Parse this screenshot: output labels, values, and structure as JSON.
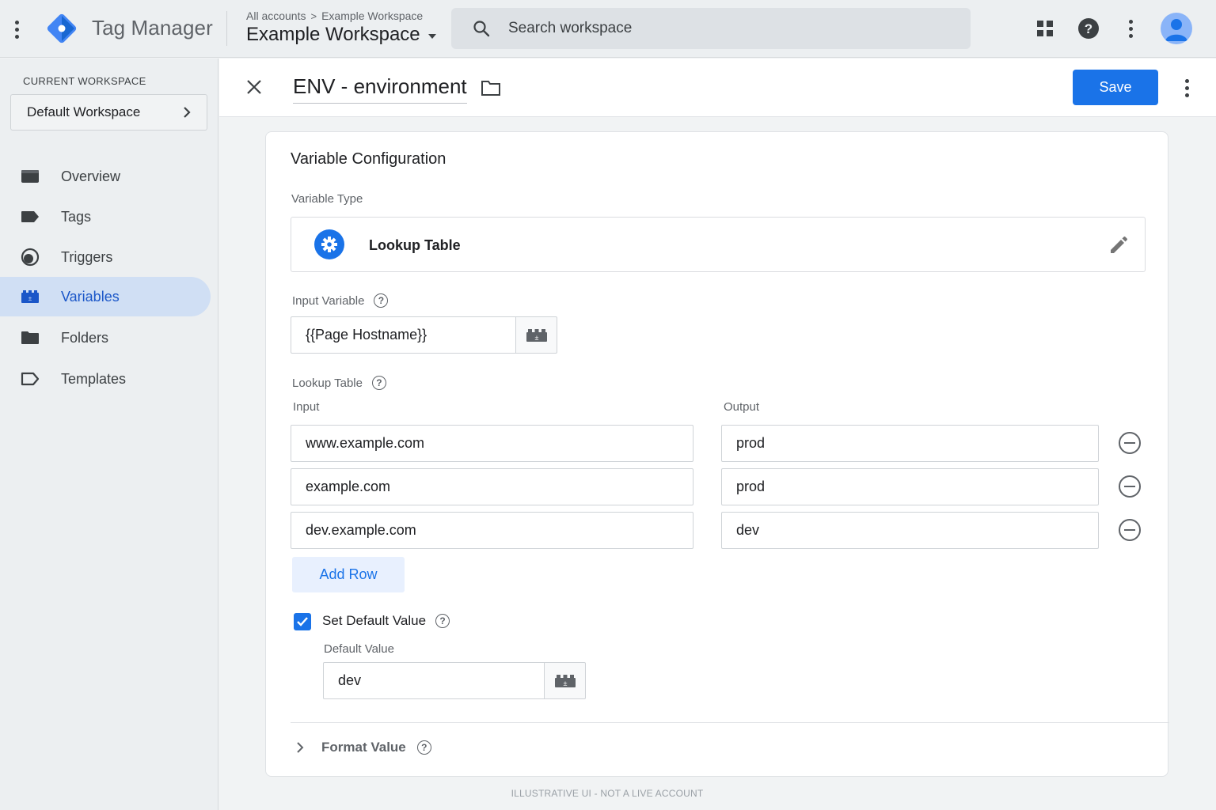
{
  "app": {
    "product_name": "Tag Manager",
    "breadcrumb": [
      "All accounts",
      "Example Workspace"
    ],
    "breadcrumb_sep": ">",
    "workspace_title": "Example Workspace",
    "search_placeholder": "Search workspace",
    "accent_color": "#1a73e8"
  },
  "sidebar": {
    "current_workspace_label": "CURRENT WORKSPACE",
    "workspace_name": "Default Workspace",
    "items": [
      {
        "label": "Overview",
        "icon": "overview-icon"
      },
      {
        "label": "Tags",
        "icon": "tag-icon"
      },
      {
        "label": "Triggers",
        "icon": "trigger-icon"
      },
      {
        "label": "Variables",
        "icon": "variables-icon",
        "active": true
      },
      {
        "label": "Folders",
        "icon": "folder-icon"
      },
      {
        "label": "Templates",
        "icon": "template-icon"
      }
    ]
  },
  "editor": {
    "variable_name": "ENV - environment",
    "save_label": "Save"
  },
  "config": {
    "title": "Variable Configuration",
    "variable_type_label": "Variable Type",
    "variable_type": "Lookup Table",
    "input_variable_label": "Input Variable",
    "input_variable_value": "{{Page Hostname}}",
    "lookup_table_label": "Lookup Table",
    "input_col": "Input",
    "output_col": "Output",
    "rows": [
      {
        "input": "www.example.com",
        "output": "prod"
      },
      {
        "input": "example.com",
        "output": "prod"
      },
      {
        "input": "dev.example.com",
        "output": "dev"
      }
    ],
    "add_row_label": "Add Row",
    "set_default_label": "Set Default Value",
    "set_default_checked": true,
    "default_value_label": "Default Value",
    "default_value": "dev",
    "format_value_label": "Format Value"
  },
  "footer_note": "ILLUSTRATIVE UI - NOT A LIVE ACCOUNT"
}
